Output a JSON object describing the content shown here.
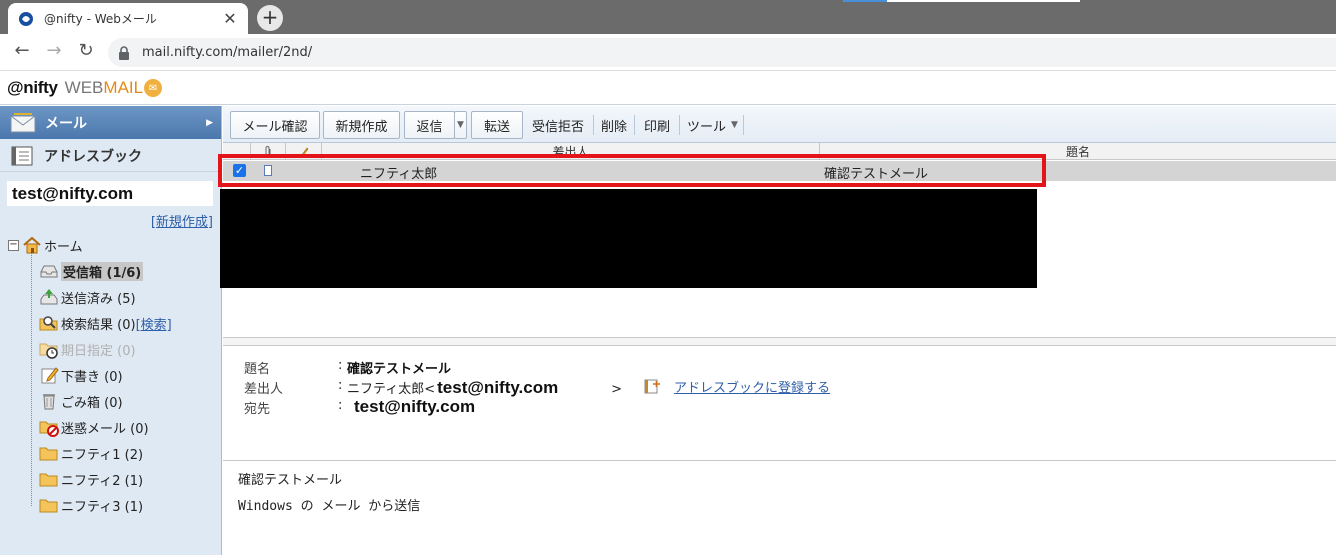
{
  "browser": {
    "tab_title": "@nifty - Webメール",
    "tab_close": "✕",
    "new_tab": "+",
    "url": "mail.nifty.com/mailer/2nd/",
    "back": "←",
    "forward": "→",
    "reload": "↻"
  },
  "header": {
    "logo_nifty": "@nifty",
    "logo_web": "WEB",
    "logo_mail": "MAIL"
  },
  "sidebar": {
    "mail_label": "メール",
    "mail_arrow": "▶",
    "addressbook_label": "アドレスブック",
    "account": "test@nifty.com",
    "new_folder_link": "[新規作成]",
    "tree_toggle": "−",
    "home_label": "ホーム",
    "folders": [
      {
        "label": "受信箱 (1/6)"
      },
      {
        "label": "送信済み (5)"
      },
      {
        "label": "検索結果 (0)",
        "link": "[検索]"
      },
      {
        "label": "期日指定 (0)"
      },
      {
        "label": "下書き (0)"
      },
      {
        "label": "ごみ箱 (0)"
      },
      {
        "label": "迷惑メール (0)"
      },
      {
        "label": "ニフティ1 (2)"
      },
      {
        "label": "ニフティ2 (1)"
      },
      {
        "label": "ニフティ3 (1)"
      }
    ]
  },
  "toolbar": {
    "check_mail": "メール確認",
    "compose": "新規作成",
    "reply": "返信",
    "reply_menu": "▼",
    "forward": "転送",
    "block": "受信拒否",
    "delete": "削除",
    "print": "印刷",
    "tools": "ツール",
    "tools_menu": "▼"
  },
  "list": {
    "columns": {
      "from": "差出人",
      "subject": "題名"
    },
    "rows": [
      {
        "checked": "✓",
        "from": "ニフティ太郎",
        "subject": "確認テストメール"
      }
    ]
  },
  "detail": {
    "subject_label": "題名",
    "from_label": "差出人",
    "to_label": "宛先",
    "colon": ":",
    "subject": "確認テストメール",
    "from_name": "ニフティ太郎<",
    "from_email": "test@nifty.com",
    "from_close": ">",
    "add_to_addressbook": "アドレスブックに登録する",
    "to_email": "test@nifty.com"
  },
  "body": {
    "lines": [
      "確認テストメール",
      "Windows の メール から送信"
    ]
  },
  "colors": {
    "sidebar_bg": "#dfe9f3",
    "mail_tab_bg": "#4a77ad",
    "highlight": "#e4141b",
    "link": "#2f5fa8",
    "logo_mail": "#e38a1a"
  }
}
